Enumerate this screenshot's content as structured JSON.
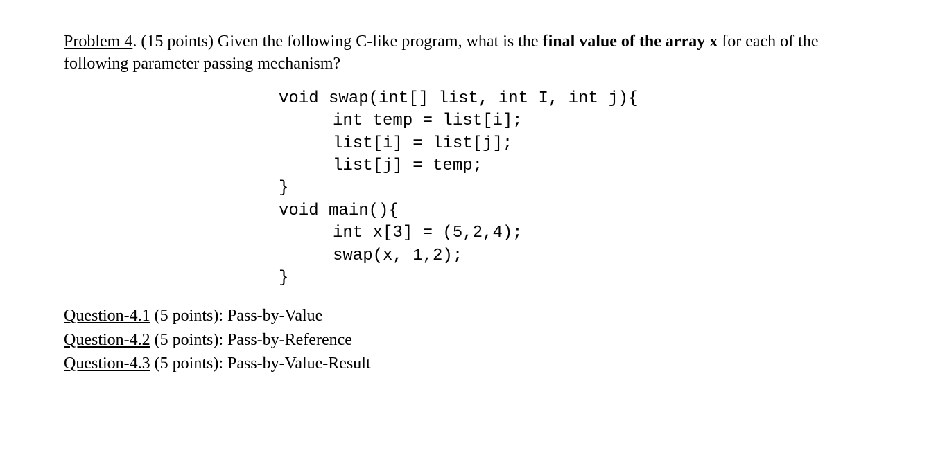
{
  "problem": {
    "label": "Problem 4",
    "points": ". (15 points) ",
    "text_before": "Given the following C-like program, what is the ",
    "bold1": "final value of the array x",
    "text_after": " for each of the following parameter passing mechanism?"
  },
  "code": {
    "line1": "void swap(int[] list, int I, int j){",
    "line2": "int temp = list[i];",
    "line3": "list[i] = list[j];",
    "line4": "list[j] = temp;",
    "line5": "}",
    "line6": "void main(){",
    "line7": "int x[3] = (5,2,4);",
    "line8": "swap(x, 1,2);",
    "line9": "}"
  },
  "questions": {
    "q1": {
      "label": "Question-4.1",
      "text": " (5 points): Pass-by-Value"
    },
    "q2": {
      "label": "Question-4.2",
      "text": " (5 points): Pass-by-Reference"
    },
    "q3": {
      "label": "Question-4.3",
      "text": " (5 points): Pass-by-Value-Result"
    }
  }
}
